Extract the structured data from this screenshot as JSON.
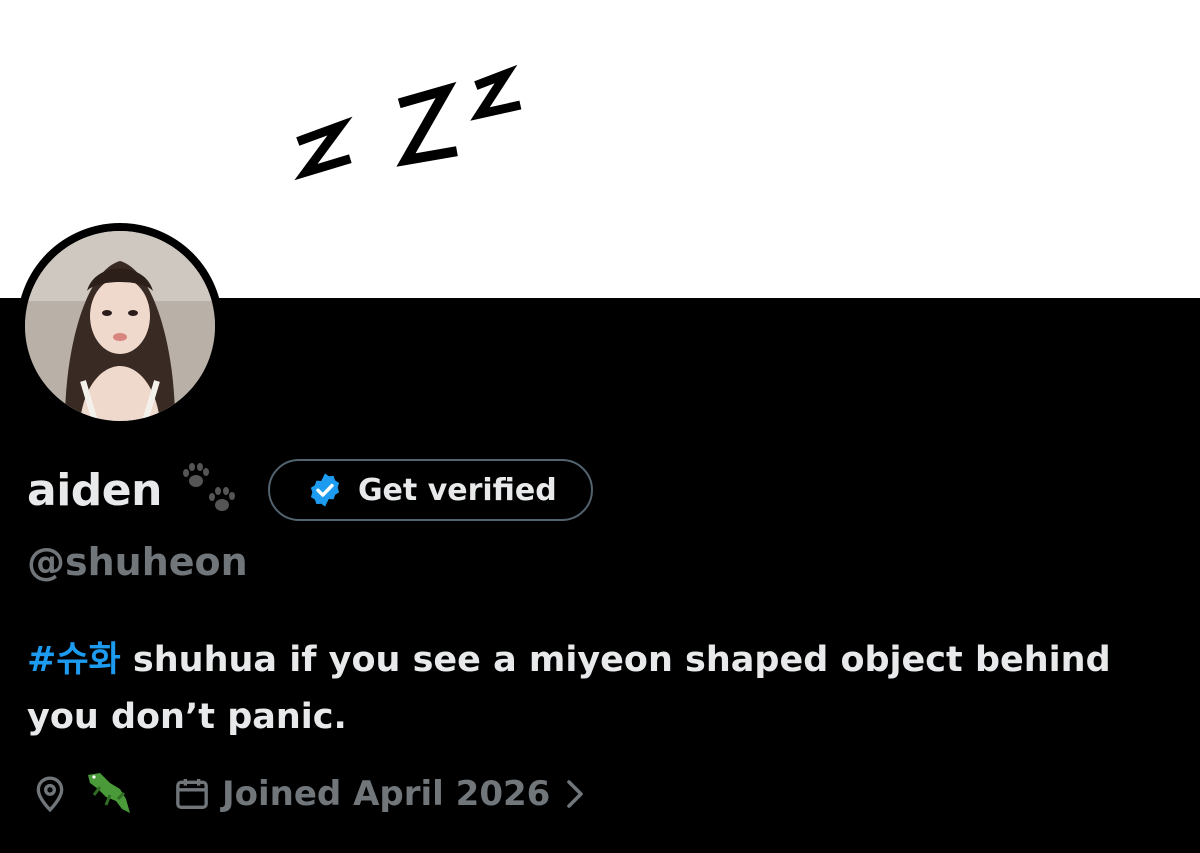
{
  "profile": {
    "display_name": "aiden",
    "name_emoji": "paw-prints",
    "handle": "@shuheon",
    "verify_button_label": "Get verified",
    "bio_hashtag": "#슈화",
    "bio_text": " shuhua if you see a miyeon shaped object behind you don’t panic.",
    "location_emoji": "crocodile",
    "joined_text": "Joined April 2026"
  },
  "colors": {
    "background": "#000000",
    "text_primary": "#e7e9ea",
    "text_secondary": "#71767b",
    "accent": "#1d9bf0",
    "banner": "#ffffff"
  },
  "icons": [
    "sleeping-zzz-icon",
    "paw-prints-icon",
    "verified-badge-icon",
    "location-pin-icon",
    "crocodile-icon",
    "calendar-icon",
    "chevron-right-icon"
  ]
}
